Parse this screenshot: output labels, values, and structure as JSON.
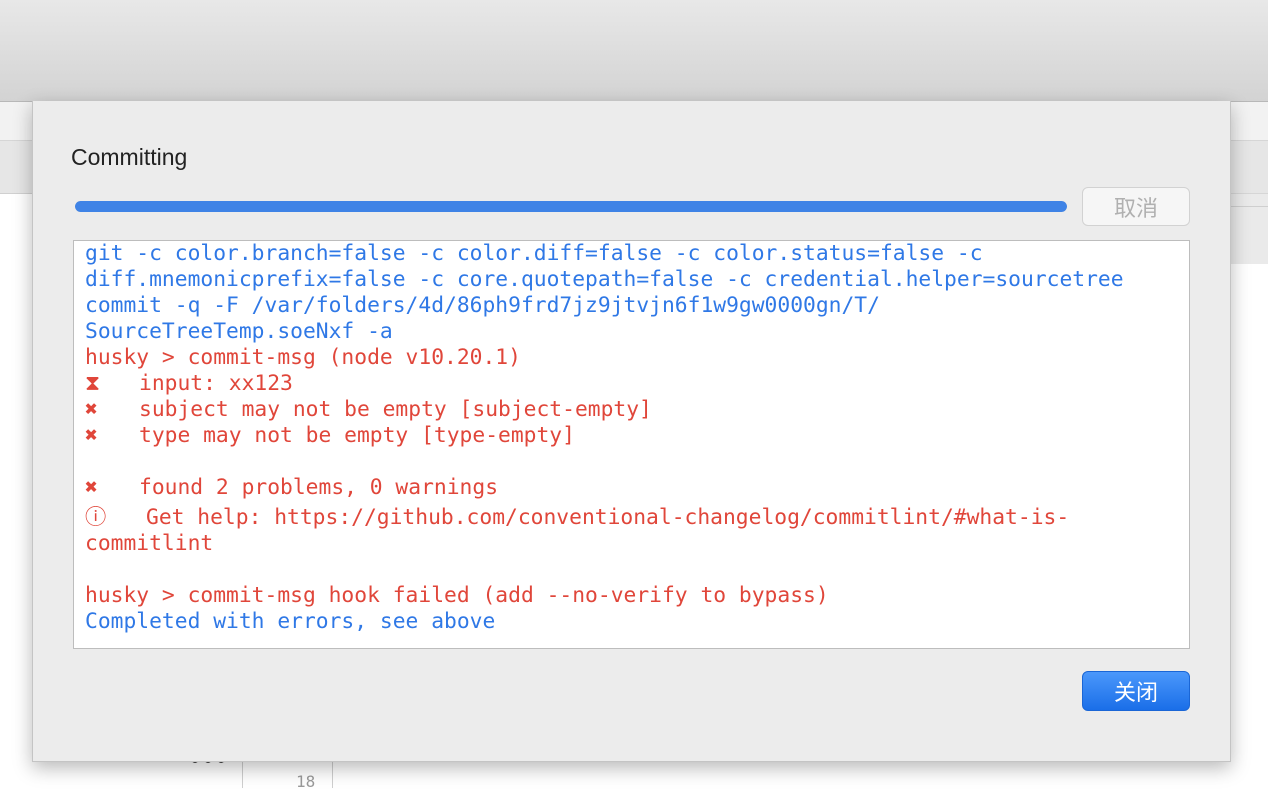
{
  "dialog": {
    "title": "Committing",
    "progress": 1.0,
    "cancel_label": "取消",
    "close_label": "关闭"
  },
  "log": {
    "lines": [
      "git -c color.branch=false -c color.diff=false -c color.status=false -c",
      "diff.mnemonicprefix=false -c core.quotepath=false -c credential.helper=sourcetree",
      "commit -q -F /var/folders/4d/86ph9frd7jz9jtvjn6f1w9gw0000gn/T/",
      "SourceTreeTemp.soeNxf -a",
      "husky > commit-msg (node v10.20.1)",
      "input: xx123",
      "subject may not be empty [subject-empty]",
      "type may not be empty [type-empty]",
      "found 2 problems, 0 warnings",
      "Get help: https://github.com/conventional-changelog/commitlint/#what-is-",
      "commitlint",
      "husky > commit-msg hook failed (add --no-verify to bypass)",
      "Completed with errors, see above"
    ],
    "icons": {
      "hourglass": "⧗",
      "error": "✖",
      "info": "ⓘ"
    }
  },
  "background": {
    "line_number": "18",
    "ellipsis": "•••"
  },
  "colors": {
    "command_blue": "#2f78e6",
    "error_red": "#e0463a",
    "progress_blue": "#3f83e6",
    "button_blue": "#2b80f5"
  }
}
